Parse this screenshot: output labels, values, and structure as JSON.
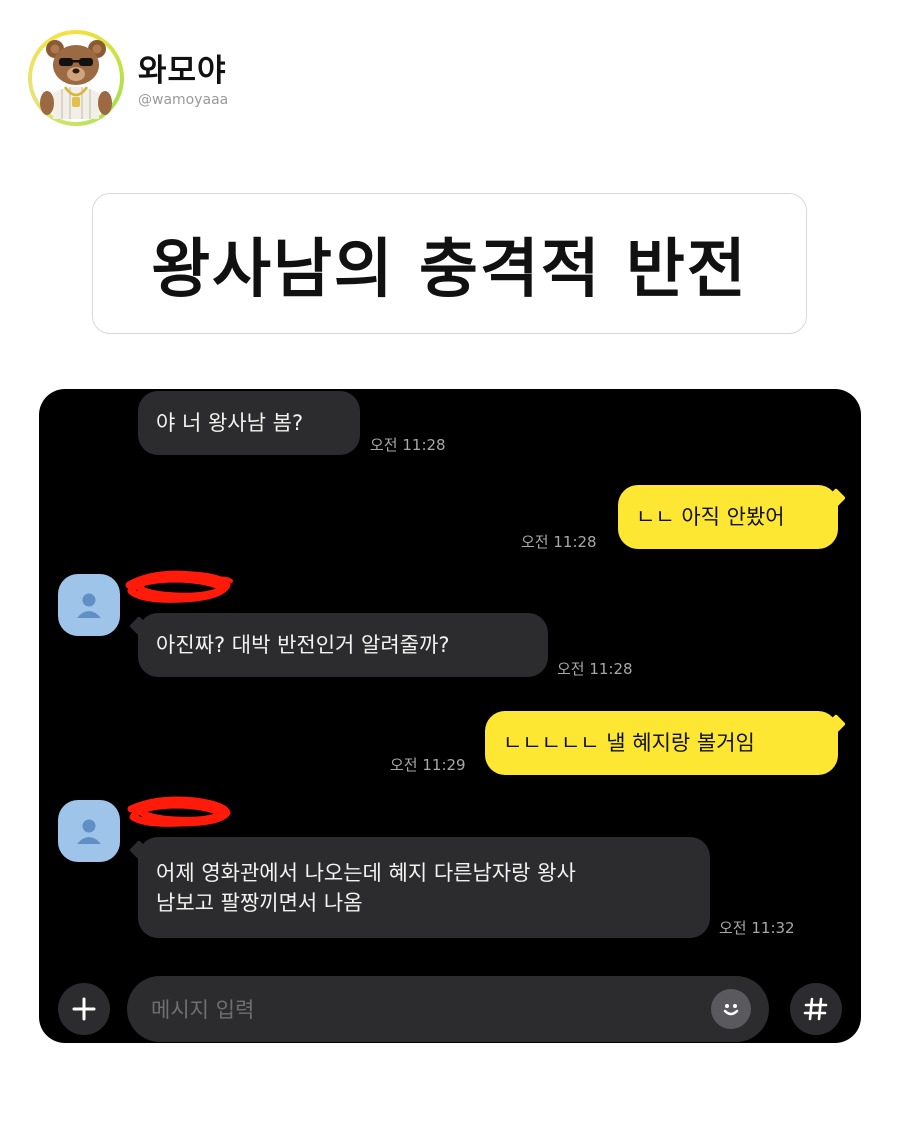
{
  "profile": {
    "name": "와모야",
    "handle": "@wamoyaaa"
  },
  "post_title": "왕사남의 충격적 반전",
  "chat": {
    "messages": [
      {
        "from": "other",
        "text": "야 너 왕사남 봄?",
        "time": "오전 11:28"
      },
      {
        "from": "me",
        "text": "ㄴㄴ 아직 안봤어",
        "time": "오전 11:28"
      },
      {
        "from": "other",
        "text": "아진짜? 대박 반전인거 알려줄까?",
        "time": "오전 11:28"
      },
      {
        "from": "me",
        "text": "ㄴㄴㄴㄴㄴ 낼 혜지랑 볼거임",
        "time": "오전 11:29"
      },
      {
        "from": "other",
        "text_line1": "어제 영화관에서 나오는데 혜지 다른남자랑 왕사",
        "text_line2": "남보고 팔짱끼면서 나옴",
        "time": "오전 11:32"
      }
    ],
    "input_placeholder": "메시지 입력",
    "plus_label": "+",
    "hash_label": "#"
  },
  "colors": {
    "chat_background": "#000000",
    "incoming_bubble": "#2c2c2e",
    "outgoing_bubble": "#fde732",
    "avatar_default": "#9fc4ea",
    "redaction": "#ff1a0a"
  },
  "icons": [
    "bear-avatar",
    "default-user-icon",
    "plus-icon",
    "emoji-icon",
    "hash-icon"
  ]
}
